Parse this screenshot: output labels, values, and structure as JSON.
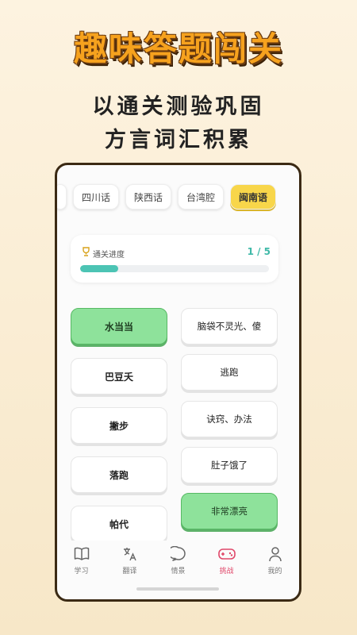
{
  "hero": {
    "title": "趣味答题闯关",
    "subtitle_line1": "以通关测验巩固",
    "subtitle_line2": "方言词汇积累"
  },
  "dialect_tabs": [
    {
      "label": ""
    },
    {
      "label": "四川话"
    },
    {
      "label": "陕西话"
    },
    {
      "label": "台湾腔"
    },
    {
      "label": "闽南语",
      "active": true
    }
  ],
  "progress": {
    "label": "通关进度",
    "count": "1 / 5",
    "fraction": 0.2,
    "color": "#4cc4b4"
  },
  "left_words": [
    {
      "text": "水当当",
      "matched": true
    },
    {
      "text": "巴豆夭",
      "matched": false
    },
    {
      "text": "撇步",
      "matched": false
    },
    {
      "text": "落跑",
      "matched": false
    },
    {
      "text": "帕代",
      "matched": false
    }
  ],
  "right_meanings": [
    {
      "text": "脑袋不灵光、傻",
      "matched": false
    },
    {
      "text": "逃跑",
      "matched": false
    },
    {
      "text": "诀窍、办法",
      "matched": false
    },
    {
      "text": "肚子饿了",
      "matched": false
    },
    {
      "text": "非常漂亮",
      "matched": true
    }
  ],
  "bottom_nav": [
    {
      "label": "学习",
      "icon": "book-icon"
    },
    {
      "label": "翻译",
      "icon": "translate-icon"
    },
    {
      "label": "情景",
      "icon": "chat-bubble-icon"
    },
    {
      "label": "挑战",
      "icon": "gamepad-icon",
      "active": true
    },
    {
      "label": "我的",
      "icon": "person-icon"
    }
  ],
  "colors": {
    "accent_yellow": "#f8d64a",
    "matched_green": "#8ee29b",
    "active_nav": "#e0486a"
  }
}
